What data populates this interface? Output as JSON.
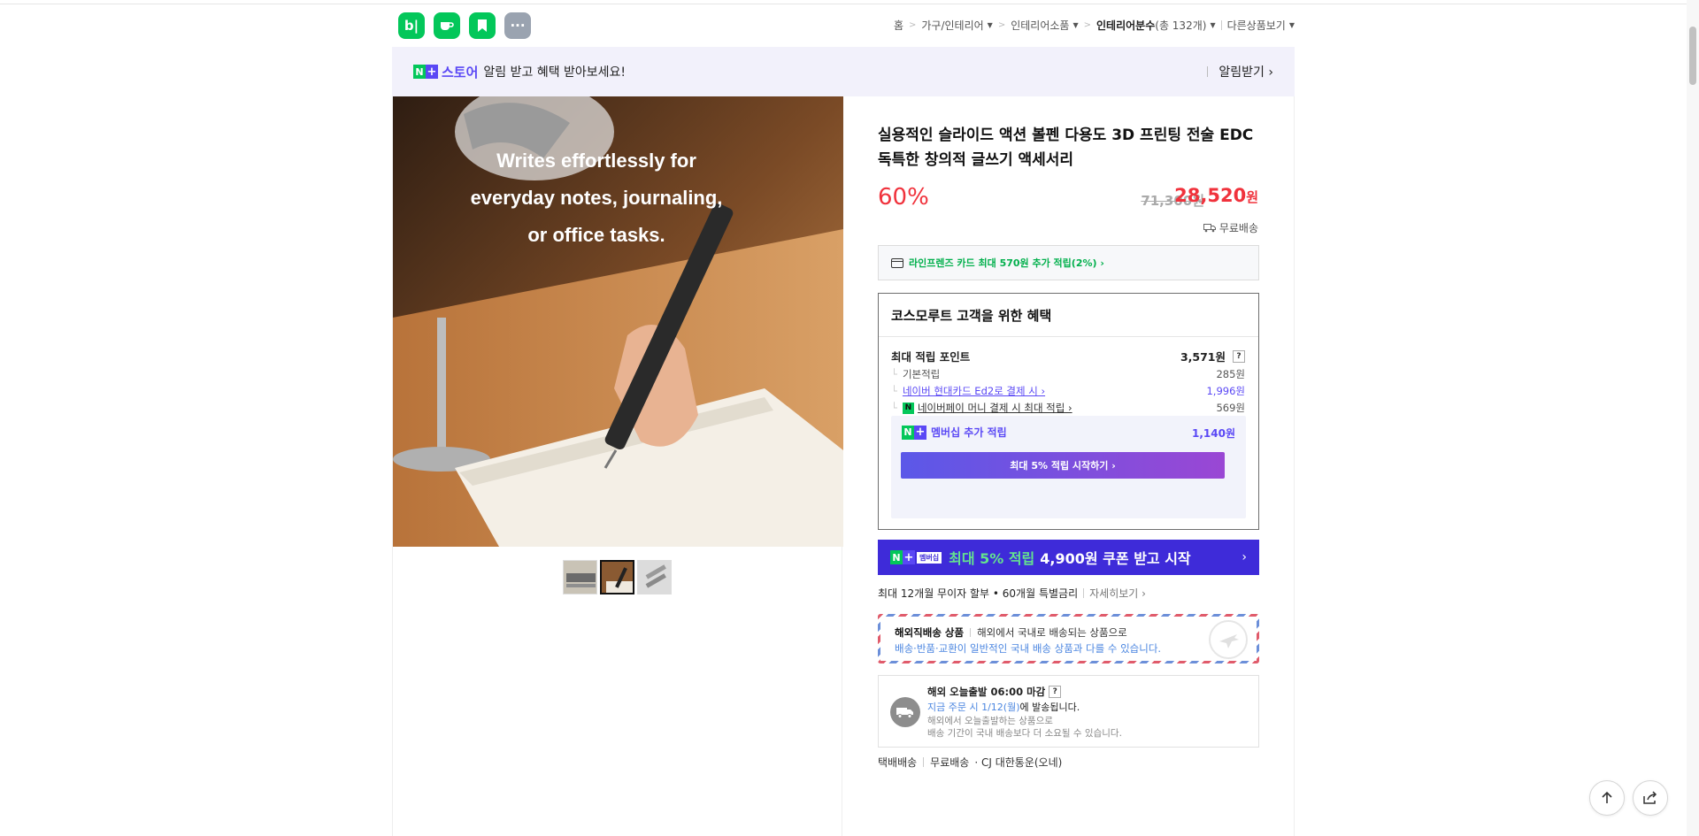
{
  "top_icons": [
    {
      "name": "blog-app-icon",
      "text": "b|"
    },
    {
      "name": "cafe-app-icon",
      "text": ""
    },
    {
      "name": "bookmark-app-icon",
      "text": ""
    },
    {
      "name": "more-apps-icon",
      "text": "···"
    }
  ],
  "breadcrumb": {
    "home": "홈",
    "cat1": "가구/인테리어",
    "cat2": "인테리어소품",
    "cat3": "인테리어분수",
    "cat3_count": "(총 132개)",
    "other": "다른상품보기"
  },
  "banner": {
    "store": "스토어",
    "message": "알림 받고 혜택 받아보세요!",
    "alarm": "알림받기 ›"
  },
  "product": {
    "title": "실용적인 슬라이드 액션 볼펜 다용도 3D 프린팅 전술 EDC 독특한 창의적 글쓰기 액세서리",
    "image_text": "Writes effortlessly for everyday notes, journaling, or office tasks.",
    "discount": "60%",
    "original_price": "71,300원",
    "price": "28,520",
    "price_unit": "원",
    "shipping": "무료배송"
  },
  "card_benefit": "라인프렌즈 카드 최대 570원 추가 적립(2%) ›",
  "benefit": {
    "heading": "코스모루트 고객을 위한 혜택",
    "max_points_label": "최대 적립 포인트",
    "max_points_value": "3,571원",
    "rows": [
      {
        "label": "기본적립",
        "value": "285원"
      },
      {
        "label": "네이버 현대카드 Ed2로 결제 시 ›",
        "value": "1,996원"
      },
      {
        "label": "네이버페이 머니 결제 시 최대 적립 ›",
        "value": "569원"
      }
    ],
    "membership_label": "멤버십 추가 적립",
    "membership_value": "1,140원",
    "membership_button": "최대 5% 적립 시작하기 ›"
  },
  "promo": {
    "badge": "멤버십",
    "highlight": "최대 5% 적립",
    "text": "4,900원 쿠폰 받고 시작",
    "arrow": "›"
  },
  "installment": {
    "text": "최대 12개월 무이자 할부 • 60개월 특별금리",
    "more": "자세히보기 ›"
  },
  "overseas": {
    "title": "해외직배송 상품",
    "desc": "해외에서 국내로 배송되는 상품으로",
    "note": "배송·반품·교환이 일반적인 국내 배송 상품과 다를 수 있습니다."
  },
  "delivery": {
    "deadline": "해외 오늘출발 06:00 마감",
    "order_prefix": "지금 주문 시 1/12(월)",
    "order_suffix": "에 발송됩니다.",
    "note1": "해외에서 오늘출발하는 상품으로",
    "note2": "배송 기간이 국내 배송보다 더 소요될 수 있습니다."
  },
  "shipinfo": {
    "method": "택배배송",
    "fee": "무료배송",
    "carrier": "· CJ 대한통운(오네)"
  },
  "colors": {
    "naver_green": "#03c75a",
    "accent_purple": "#5a48f5",
    "price_red": "#f0323c"
  }
}
